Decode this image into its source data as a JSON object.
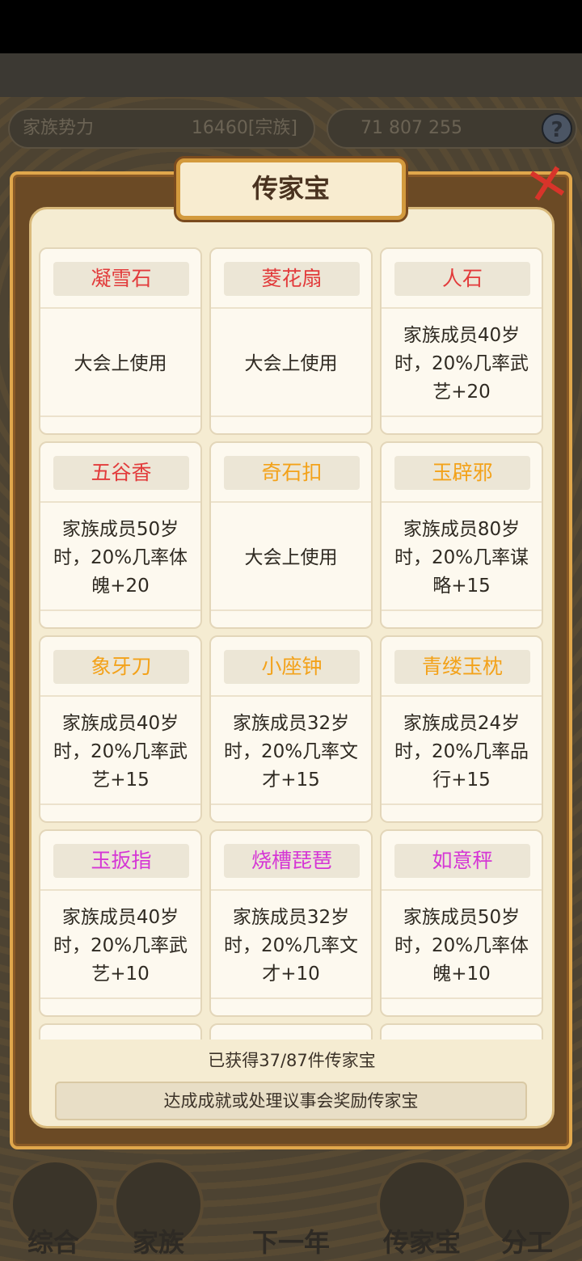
{
  "background": {
    "power_label": "家族势力",
    "power_value": "16460[宗族]",
    "resources": "71 807 255"
  },
  "modal": {
    "title": "传家宝",
    "close_icon": "close-x-icon",
    "count_text": "已获得37/87件传家宝",
    "hint": "达成成就或处理议事会奖励传家宝"
  },
  "items": [
    {
      "name": "凝雪石",
      "desc": "大会上使用",
      "color": "#e23b3b"
    },
    {
      "name": "菱花扇",
      "desc": "大会上使用",
      "color": "#e23b3b"
    },
    {
      "name": "人石",
      "desc": "家族成员40岁时，20%几率武艺+20",
      "color": "#e23b3b"
    },
    {
      "name": "五谷香",
      "desc": "家族成员50岁时，20%几率体魄+20",
      "color": "#e23b3b"
    },
    {
      "name": "奇石扣",
      "desc": "大会上使用",
      "color": "#f3a21a"
    },
    {
      "name": "玉辟邪",
      "desc": "家族成员80岁时，20%几率谋略+15",
      "color": "#f3a21a"
    },
    {
      "name": "象牙刀",
      "desc": "家族成员40岁时，20%几率武艺+15",
      "color": "#f3a21a"
    },
    {
      "name": "小座钟",
      "desc": "家族成员32岁时，20%几率文才+15",
      "color": "#f3a21a"
    },
    {
      "name": "青缕玉枕",
      "desc": "家族成员24岁时，20%几率品行+15",
      "color": "#f3a21a"
    },
    {
      "name": "玉扳指",
      "desc": "家族成员40岁时，20%几率武艺+10",
      "color": "#d536d5"
    },
    {
      "name": "烧槽琵琶",
      "desc": "家族成员32岁时，20%几率文才+10",
      "color": "#d536d5"
    },
    {
      "name": "如意秤",
      "desc": "家族成员50岁时，20%几率体魄+10",
      "color": "#d536d5"
    }
  ],
  "nav": [
    "综合",
    "家族",
    "下一年",
    "传家宝",
    "分工"
  ]
}
